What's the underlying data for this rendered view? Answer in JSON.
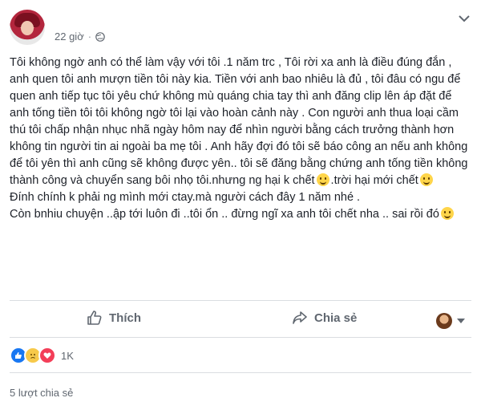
{
  "header": {
    "timestamp": "22 giờ",
    "privacy_icon": "globe-icon",
    "options_icon": "chevron-down-icon"
  },
  "post": {
    "paragraph_1_a": "Tôi không ngờ anh có thể làm vậy với tôi .1 năm trc , Tôi rời xa anh là điều đúng đắn , anh quen tôi anh mượn tiền tôi này kia. Tiền với anh bao nhiêu là đủ , tôi đâu có ngu để quen anh tiếp tục tôi yêu chứ không mù quáng chia tay thì anh đăng clip lên áp đặt để anh tống tiền tôi tôi không ngờ tôi lại vào hoàn cảnh này . Con người anh thua loại cầm thú tôi chấp nhận nhục nhã ngày hôm nay để nhìn người bằng cách trưởng thành hơn không tin người tin ai ngoài ba mẹ tôi . Anh hãy đợi đó tôi sẽ báo công an nếu anh không để tôi yên thì anh cũng sẽ không được yên.. tôi sẽ đăng bằng chứng anh tống tiền không thành công và chuyển sang bôi nhọ tôi.nhưng ng hại k chết",
    "paragraph_1_b": ".trời hại mới chết",
    "paragraph_2": "Đính chính k phải ng mình mới ctay.mà người cách đây 1 năm nhé .",
    "paragraph_3": "Còn bnhiu chuyện ..ập tới luôn đi ..tôi ổn .. đừng ngĩ xa anh tôi chết nha .. sai rồi đó"
  },
  "actions": {
    "like_label": "Thích",
    "share_label": "Chia sẻ"
  },
  "reactions": {
    "count": "1K",
    "types": [
      "like",
      "sad",
      "love"
    ]
  },
  "footer": {
    "shares_text": "5 lượt chia sẻ"
  },
  "colors": {
    "text": "#1d2129",
    "secondary": "#606770",
    "like_blue": "#1877f2",
    "love_red": "#f33e58"
  }
}
